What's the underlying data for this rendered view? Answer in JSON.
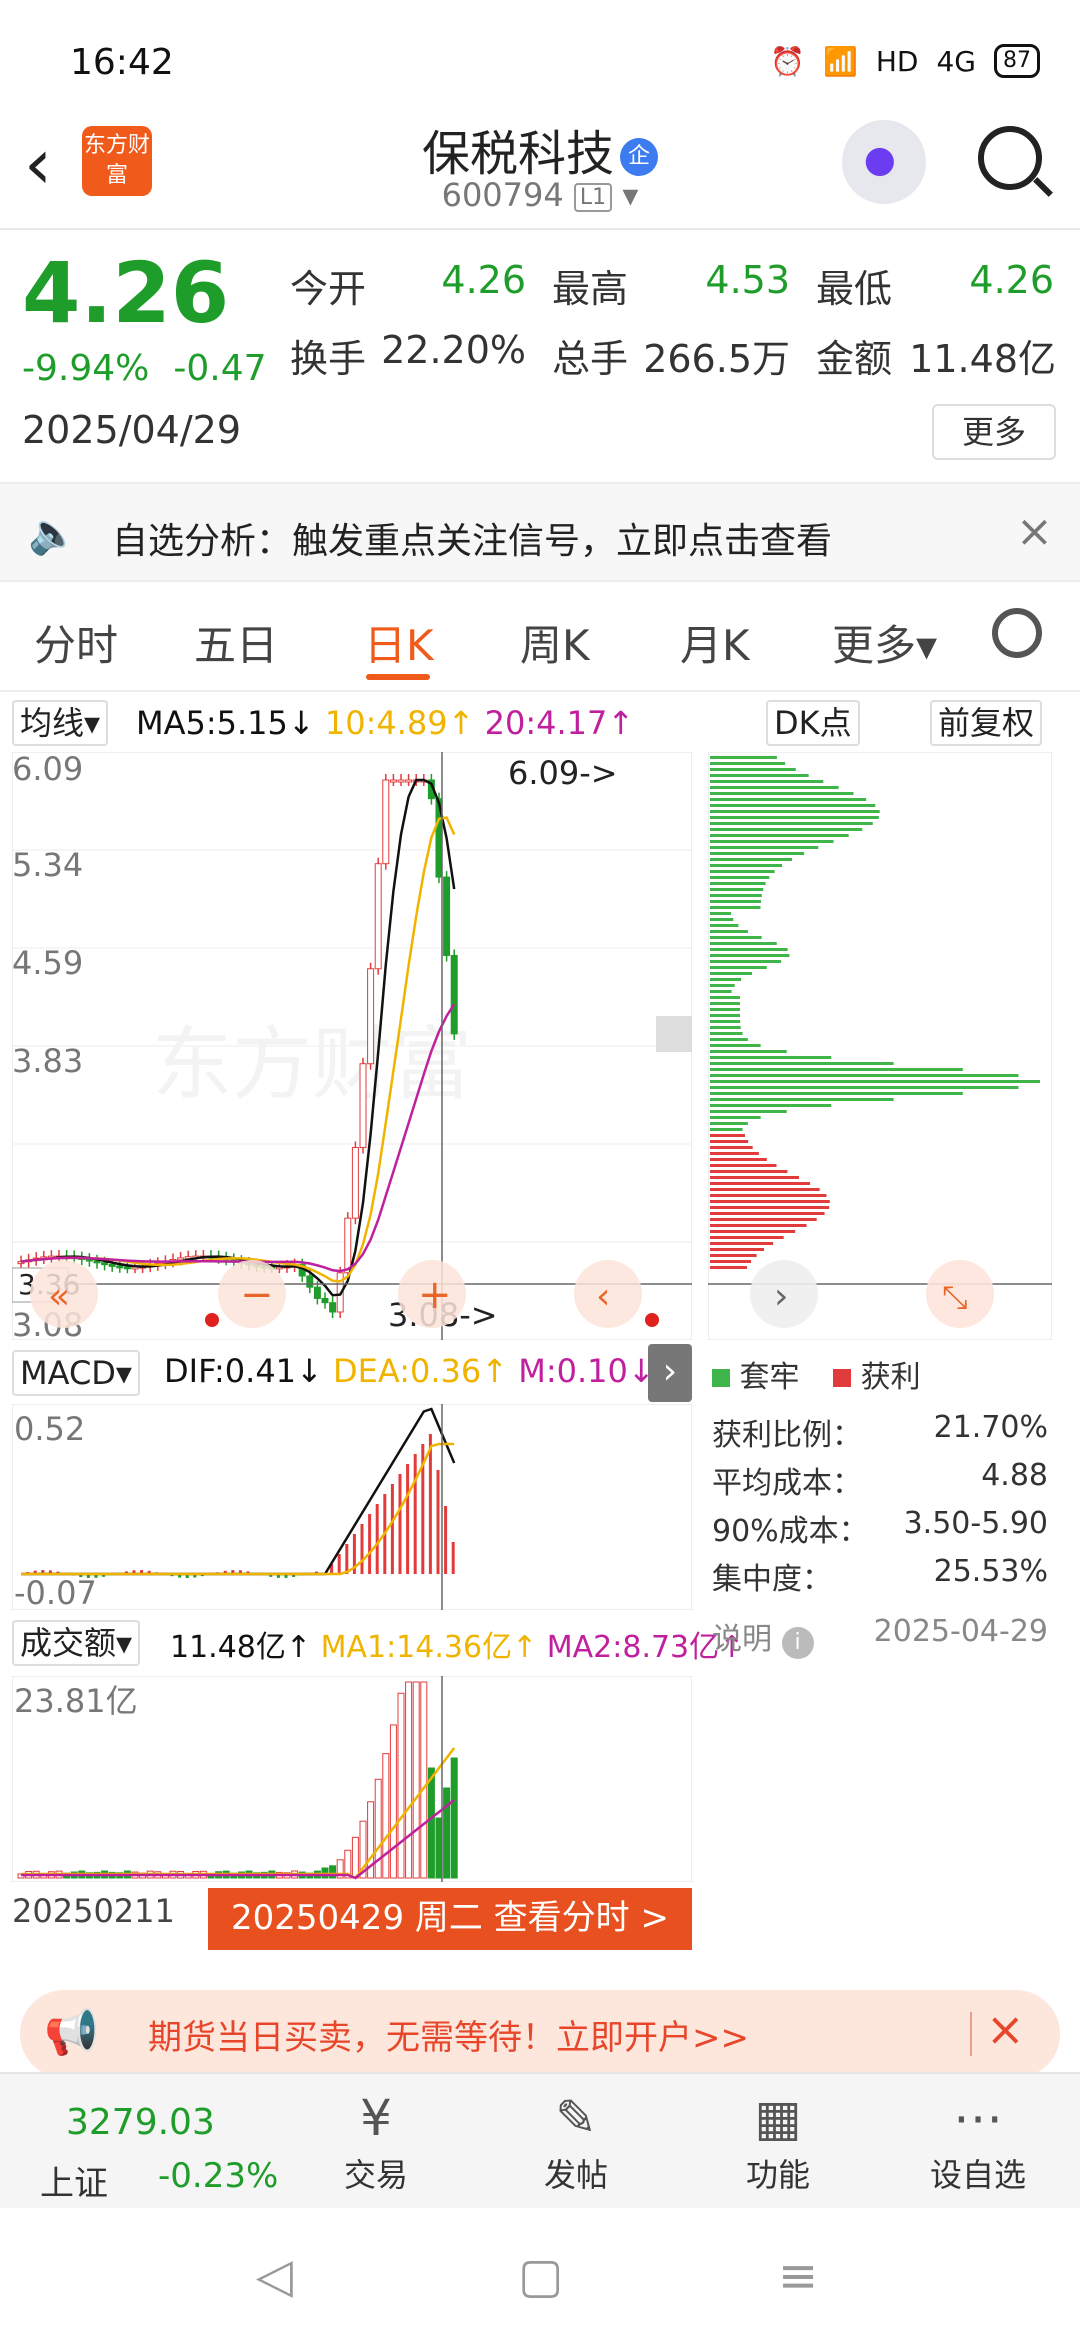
{
  "status": {
    "time": "16:42",
    "network": "HD",
    "signal": "4G",
    "battery": "87"
  },
  "header": {
    "back": "‹",
    "logo": "东方财富",
    "title": "保税科技",
    "badge": "企",
    "code": "600794",
    "code_tag": "L1"
  },
  "quote": {
    "price": "4.26",
    "change_pct": "-9.94%",
    "change": "-0.47",
    "date": "2025/04/29",
    "stats": [
      {
        "label": "今开",
        "value": "4.26"
      },
      {
        "label": "最高",
        "value": "4.53"
      },
      {
        "label": "最低",
        "value": "4.26"
      },
      {
        "label": "换手",
        "value": "22.20%"
      },
      {
        "label": "总手",
        "value": "266.5万"
      },
      {
        "label": "金额",
        "value": "11.48亿"
      }
    ],
    "more": "更多"
  },
  "analysis": {
    "text": "自选分析：触发重点关注信号，立即点击查看",
    "close": "×"
  },
  "tabs": [
    "分时",
    "五日",
    "日K",
    "周K",
    "月K",
    "更多▾"
  ],
  "kline": {
    "indicator_select": "均线▾",
    "ma5": "MA5:5.15↓",
    "ma10": "10:4.89↑",
    "ma20": "20:4.17↑",
    "dk_select": "DK点",
    "adjust": "前复权",
    "y_labels": [
      "6.09",
      "5.34",
      "4.59",
      "3.83",
      "3.08"
    ],
    "high_marker": "6.09->",
    "low_marker": "3.08->",
    "crosshair_price": "3.36",
    "watermark": "东方财富"
  },
  "macd": {
    "select": "MACD▾",
    "dif": "DIF:0.41↓",
    "dea": "DEA:0.36↑",
    "m": "M:0.10↓",
    "y_top": "0.52",
    "y_bottom": "-0.07"
  },
  "volume": {
    "select": "成交额▾",
    "value": "11.48亿↑",
    "ma1": "MA1:14.36亿↑",
    "ma2": "MA2:8.73亿↑",
    "y_top": "23.81亿",
    "start_date": "20250211",
    "end_label": "20250429 周二 查看分时 >"
  },
  "chips": {
    "legend_hold": "套牢",
    "legend_profit": "获利",
    "rows": [
      {
        "label": "获利比例：",
        "value": "21.70%"
      },
      {
        "label": "平均成本：",
        "value": "4.88"
      },
      {
        "label": "90%成本：",
        "value": "3.50-5.90"
      },
      {
        "label": "集中度：",
        "value": "25.53%"
      }
    ],
    "note": "说明",
    "note_date": "2025-04-29"
  },
  "banner": {
    "text": "期货当日买卖，无需等待！立即开户>>",
    "close": "×"
  },
  "bottom": {
    "index_value": "3279.03",
    "index_name": "上证",
    "index_change": "-0.23%",
    "items": [
      {
        "icon": "yen-icon",
        "label": "交易"
      },
      {
        "icon": "edit-icon",
        "label": "发帖"
      },
      {
        "icon": "grid-icon",
        "label": "功能"
      },
      {
        "icon": "more-icon",
        "label": "设自选"
      }
    ]
  },
  "colors": {
    "up": "#e23b3b",
    "down": "#1f9d2b",
    "accent": "#f05a1a",
    "ma5": "#111111",
    "ma10": "#f0b400",
    "ma20": "#c0209e"
  }
}
